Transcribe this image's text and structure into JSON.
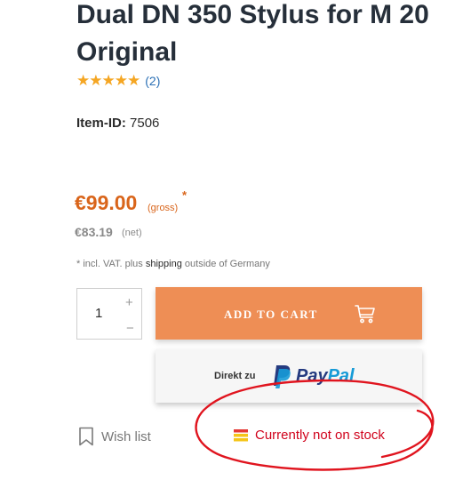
{
  "product": {
    "title_line1": "Dual DN 350 Stylus for M 20",
    "title_line2": "Original",
    "rating": {
      "stars": 5,
      "count": "(2)",
      "star_color": "#f5a623"
    },
    "item_id_label": "Item-ID:",
    "item_id_value": "7506"
  },
  "pricing": {
    "gross_price": "€99.00",
    "gross_tag": "(gross)",
    "footnote_marker": "*",
    "net_price": "€83.19",
    "net_tag": "(net)",
    "vat_note_prefix": "* incl. VAT. plus",
    "vat_note_link": "shipping",
    "vat_note_suffix": "outside of Germany",
    "accent_color": "#d9651b"
  },
  "quantity": {
    "value": "1",
    "plus": "+",
    "minus": "−"
  },
  "cart_button": {
    "label": "ADD TO CART",
    "icon": "cart-icon",
    "color": "#ee8e55"
  },
  "paypal_button": {
    "prefix": "Direkt zu",
    "brand_pay": "Pay",
    "brand_pal": "Pal",
    "icon": "paypal-logo-icon"
  },
  "wishlist": {
    "label": "Wish list",
    "icon": "bookmark-icon"
  },
  "stock": {
    "label": "Currently not on stock",
    "icon": "stock-status-icon",
    "color": "#d0021b"
  },
  "annotation": {
    "shape": "red-hand-drawn-circle",
    "color": "#e0141e"
  }
}
